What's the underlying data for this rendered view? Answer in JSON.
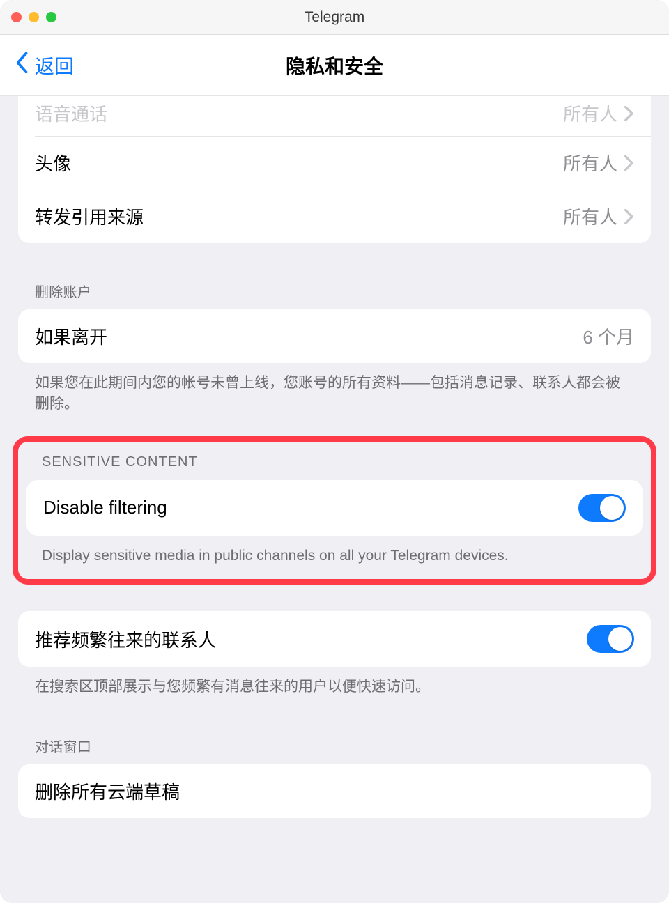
{
  "window": {
    "title": "Telegram"
  },
  "nav": {
    "back": "返回",
    "title": "隐私和安全"
  },
  "privacy_rows": [
    {
      "label": "语音通话",
      "value": "所有人"
    },
    {
      "label": "头像",
      "value": "所有人"
    },
    {
      "label": "转发引用来源",
      "value": "所有人"
    }
  ],
  "delete_account": {
    "header": "删除账户",
    "row_label": "如果离开",
    "row_value": "6 个月",
    "footer": "如果您在此期间内您的帐号未曾上线，您账号的所有资料——包括消息记录、联系人都会被删除。"
  },
  "sensitive": {
    "header": "SENSITIVE CONTENT",
    "row_label": "Disable filtering",
    "footer": "Display sensitive media in public channels on all your Telegram devices."
  },
  "frequent": {
    "row_label": "推荐频繁往来的联系人",
    "footer": "在搜索区顶部展示与您频繁有消息往来的用户以便快速访问。"
  },
  "chatwindow": {
    "header": "对话窗口",
    "row_label": "删除所有云端草稿"
  }
}
